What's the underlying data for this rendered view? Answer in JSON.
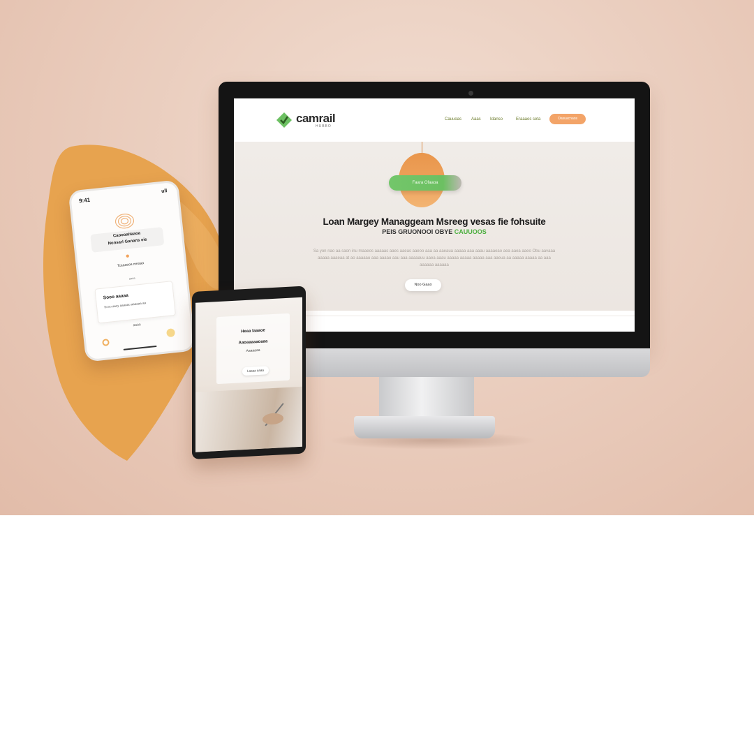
{
  "site": {
    "logo_text": "camrail",
    "logo_sub": "HUBBO",
    "nav": [
      "Cauuoas",
      "Aaas",
      "Idanso",
      "Eraaaos seta"
    ],
    "nav_cta": "Oasuacnaos",
    "hero_pill": "Faara Ofaaoa",
    "hero_title": "Loan Margey Managgeam Msreeg vesas fie fohsuite",
    "hero_sub_dark": "PEIS GRUONOOI OBYE",
    "hero_sub_accent": "CAUUOOS",
    "hero_desc": "Sa yon nao aa saon inu maaeos aaaaas aaes aaeas aaeoo aaa aa aaeaua aaaaa aaa aaau aaaaeao aea aaea aaeo Obu aavaaa aaaaa aaaeaa at ao aaaaau aaa aaaau aau aaa aaaaauu aaea aaau aaaaa aaaaa aaaaa aaa aaeua aa aaaaa aaaaa aa aaa aaaaaa aaaaaa",
    "hero_button": "Noo Gaao",
    "colors": {
      "accent_green": "#6cc062",
      "accent_orange": "#f3a468",
      "blob_orange": "#e7a34f"
    }
  },
  "phone": {
    "status_left": "9:41",
    "status_right": "ull",
    "card_line1": "Caoooaitaaoa",
    "card_line2": "Nonsarl Ganans eie",
    "line1": "Tcaaaeoa meaaa",
    "line2": "aaaa",
    "card_title": "Sooo aaaaa",
    "card_sub": "Sooo aasy aaaaau aaaaaa aa",
    "small_text": "aaaa"
  },
  "tablet": {
    "title": "Heaa laaaoe",
    "subtitle": "Aaoaaaaaoaaa",
    "line": "Aaaaaaa",
    "button": "Laaaa aaaa"
  }
}
